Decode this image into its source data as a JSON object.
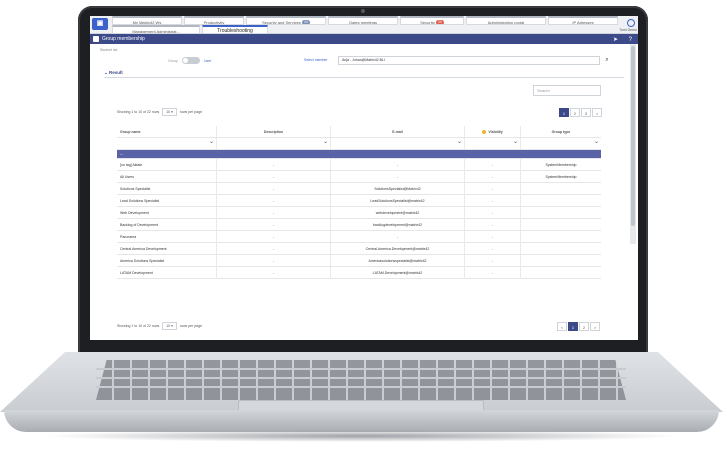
{
  "tabs": {
    "row1": [
      {
        "label": "My Matrix42 Ws"
      },
      {
        "label": "Productivity"
      },
      {
        "label": "Security and Services",
        "badge": "24"
      },
      {
        "label": "Gates meetings"
      },
      {
        "label": "Security",
        "badge": "24"
      },
      {
        "label": "Administration portal"
      },
      {
        "label": "IP Adresses"
      }
    ],
    "row2": [
      {
        "label": "Management Administrat..."
      },
      {
        "label": "Troubleshooting"
      }
    ],
    "user": "Tomi Demo"
  },
  "header": {
    "title": "Group membership"
  },
  "breadcrumb": "Student list",
  "filter": {
    "show_label": "Group",
    "user_label": "User",
    "select_label": "Select member",
    "select_value": "Anja - Johan@Matrix42.BLI"
  },
  "section": {
    "title": "Result"
  },
  "search": {
    "placeholder": "Search"
  },
  "pagination": {
    "info_prefix": "Showing 1 to 10 of 22 rows",
    "per_page": "10",
    "info_suffix": "rows per page",
    "pages": [
      "1",
      "2",
      "3",
      ">"
    ],
    "bottom_pages": [
      "<",
      "1",
      "2",
      ">"
    ]
  },
  "table": {
    "columns": [
      "Group name",
      "Description",
      "E-mail",
      "Visibility",
      "Group type"
    ],
    "selected_row": "---",
    "rows": [
      {
        "name": "[no tag] Aktale",
        "description": "-",
        "email": "-",
        "visibility": "-",
        "type": "SystemMembership"
      },
      {
        "name": "All Users",
        "description": "-",
        "email": "-",
        "visibility": "-",
        "type": "SystemMembership"
      },
      {
        "name": "Solutions Specialist",
        "description": "-",
        "email": "SolutionsSpecialist@Matrix42",
        "visibility": "-",
        "type": ""
      },
      {
        "name": "Lead Solutions Specialist",
        "description": "-",
        "email": "LeadSolutionsSpecialist@matrix42",
        "visibility": "-",
        "type": ""
      },
      {
        "name": "Web Development",
        "description": "-",
        "email": "webdevelopment@matrix42",
        "visibility": "-",
        "type": ""
      },
      {
        "name": "Backlog of Development",
        "description": "-",
        "email": "backlogdevelopment@matrix42",
        "visibility": "-",
        "type": ""
      },
      {
        "name": "Panorama",
        "description": "-",
        "email": "-",
        "visibility": "-",
        "type": ""
      },
      {
        "name": "Central America Development",
        "description": "-",
        "email": "Central.America.Development@matrix42",
        "visibility": "-",
        "type": ""
      },
      {
        "name": "America Solutions Specialist",
        "description": "-",
        "email": "Americasolutionsspecialist@matrix42",
        "visibility": "-",
        "type": ""
      },
      {
        "name": "LATAM Development",
        "description": "-",
        "email": "LATAM.Development@matrix42",
        "visibility": "-",
        "type": ""
      }
    ]
  }
}
